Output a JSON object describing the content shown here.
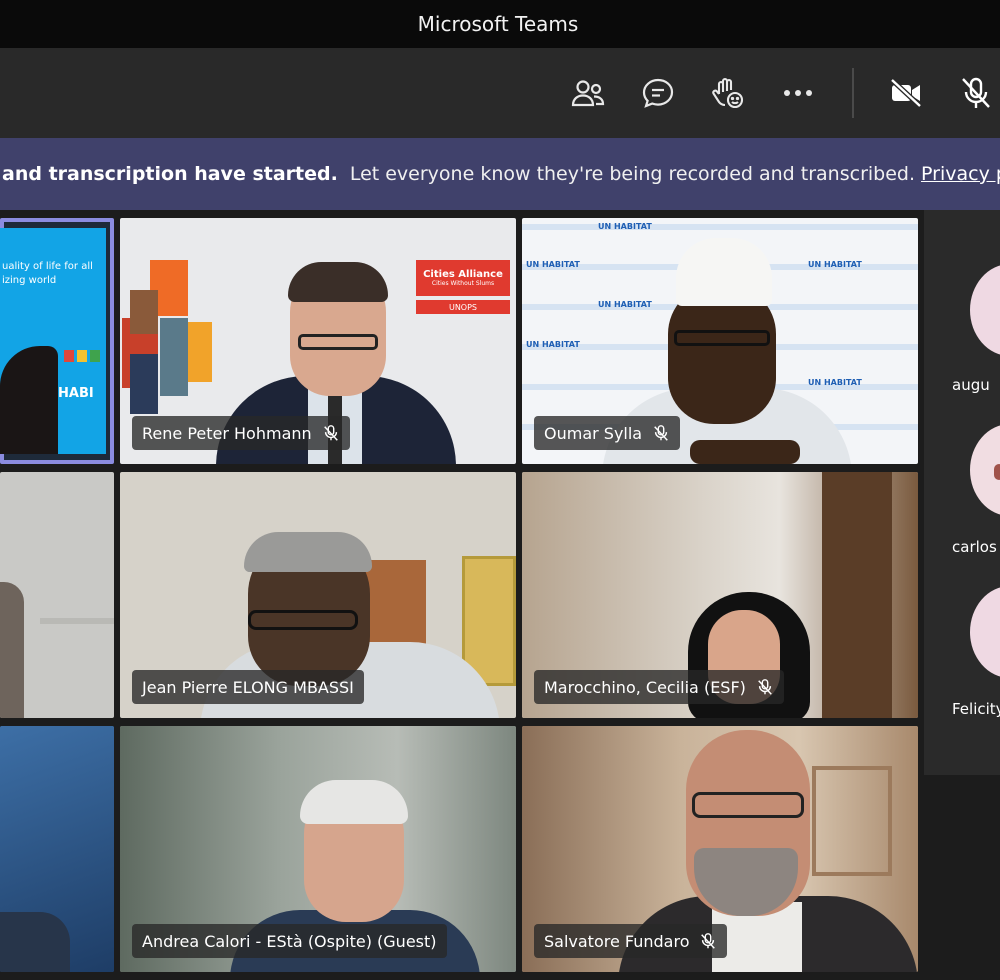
{
  "window": {
    "title": "Microsoft Teams"
  },
  "toolbar": {
    "icons": [
      "participants-icon",
      "chat-icon",
      "raise-hand-icon",
      "more-icon",
      "camera-off-icon",
      "mic-off-icon"
    ]
  },
  "banner": {
    "bold": "and transcription have started.",
    "text": "Let everyone know they're being recorded and transcribed.",
    "link": "Privacy policy"
  },
  "tiles": [
    {
      "name": "",
      "muted": false
    },
    {
      "name": "Rene Peter Hohmann",
      "muted": true
    },
    {
      "name": "Oumar Sylla",
      "muted": true
    },
    {
      "name": "",
      "muted": false
    },
    {
      "name": "Jean Pierre ELONG MBASSI",
      "muted": false
    },
    {
      "name": "Marocchino, Cecilia (ESF)",
      "muted": true
    },
    {
      "name": "",
      "muted": false
    },
    {
      "name": "Andrea Calori - EStà (Ospite) (Guest)",
      "muted": false
    },
    {
      "name": "Salvatore Fundaro",
      "muted": true
    }
  ],
  "slide": {
    "line1": "uality of life for all",
    "line2": "izing world",
    "badge": "HABI"
  },
  "logo": {
    "name": "Cities Alliance",
    "tagline": "Cities Without Slums",
    "org": "UNOPS"
  },
  "backdrop": {
    "brand": "UN HABITAT"
  },
  "sidebar": {
    "participants": [
      {
        "name": "augu"
      },
      {
        "name": "carlos"
      },
      {
        "name": "Felicity"
      }
    ]
  },
  "colors": {
    "banner": "#40416b",
    "active_outline": "#8b8ce0"
  }
}
